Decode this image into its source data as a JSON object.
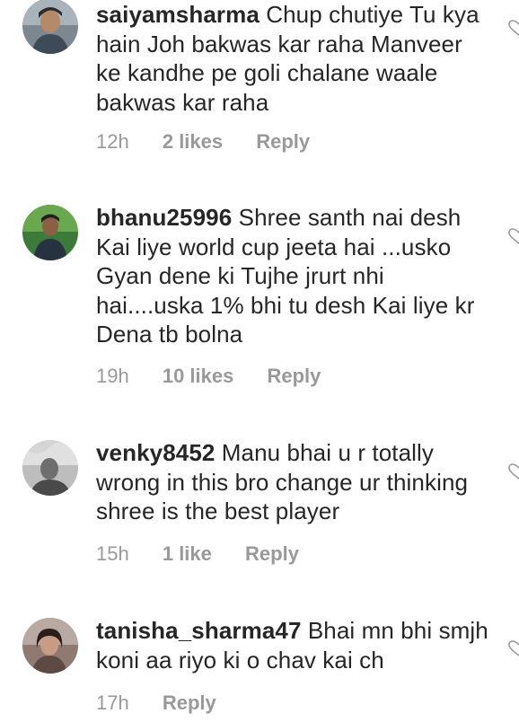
{
  "comments": [
    {
      "username": "saiyamsharma",
      "text": "Chup chutiye Tu kya hain Joh bakwas kar raha Manveer ke kandhe pe goli chalane waale bakwas kar raha",
      "time": "12h",
      "likes": "2 likes",
      "reply_label": "Reply",
      "avatar": "profile-photo"
    },
    {
      "username": "bhanu25996",
      "text": "Shree santh nai desh Kai liye world cup jeeta hai ...usko Gyan dene ki Tujhe jrurt nhi hai....uska 1% bhi tu desh Kai liye kr Dena tb bolna",
      "time": "19h",
      "likes": "10 likes",
      "reply_label": "Reply",
      "avatar": "profile-photo"
    },
    {
      "username": "venky8452",
      "text": "Manu bhai u r totally wrong in this bro change ur thinking shree is the best player",
      "time": "15h",
      "likes": "1 like",
      "reply_label": "Reply",
      "avatar": "profile-photo"
    },
    {
      "username": "tanisha_sharma47",
      "text": "Bhai mn bhi smjh koni aa riyo ki o chav kai ch",
      "time": "17h",
      "likes": "",
      "reply_label": "Reply",
      "avatar": "profile-photo"
    }
  ],
  "icons": {
    "like": "heart-outline-icon"
  },
  "colors": {
    "text": "#262626",
    "meta": "#999999",
    "background": "#ffffff"
  }
}
